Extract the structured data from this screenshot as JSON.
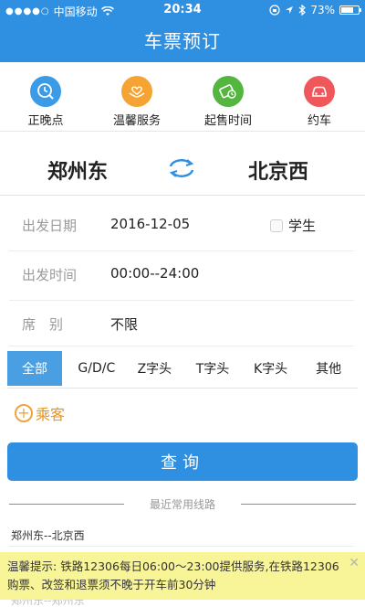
{
  "status_bar": {
    "carrier": "中国移动",
    "time": "20:34",
    "battery": "73%",
    "battery_level": 0.73
  },
  "header": {
    "title": "车票预订"
  },
  "shortcuts": [
    {
      "label": "正晚点",
      "icon": "clock-search-icon",
      "color": "#3b9be6"
    },
    {
      "label": "温馨服务",
      "icon": "heart-hands-icon",
      "color": "#f5a433"
    },
    {
      "label": "起售时间",
      "icon": "ticket-clock-icon",
      "color": "#55b63f"
    },
    {
      "label": "约车",
      "icon": "car-icon",
      "color": "#f0575b"
    }
  ],
  "route": {
    "from": "郑州东",
    "to": "北京西",
    "swap_icon": "swap-arrows-icon",
    "accent": "#2f8fe0"
  },
  "form": {
    "date_label": "出发日期",
    "date_value": "2016-12-05",
    "student_label": "学生",
    "time_label": "出发时间",
    "time_value": "00:00--24:00",
    "seat_label": "席　别",
    "seat_value": "不限"
  },
  "filters": [
    "全部",
    "G/D/C",
    "Z字头",
    "T字头",
    "K字头",
    "其他"
  ],
  "passenger": {
    "label": "乘客"
  },
  "query_button": {
    "label": "查询"
  },
  "recent": {
    "title": "最近常用线路",
    "items": [
      "郑州东--北京西",
      "郑州东--郑州东"
    ]
  },
  "tip": {
    "title": "温馨提示:",
    "text": " 铁路12306每日06:00～23:00提供服务,在铁路12306购票、改签和退票须不晚于开车前30分钟"
  }
}
